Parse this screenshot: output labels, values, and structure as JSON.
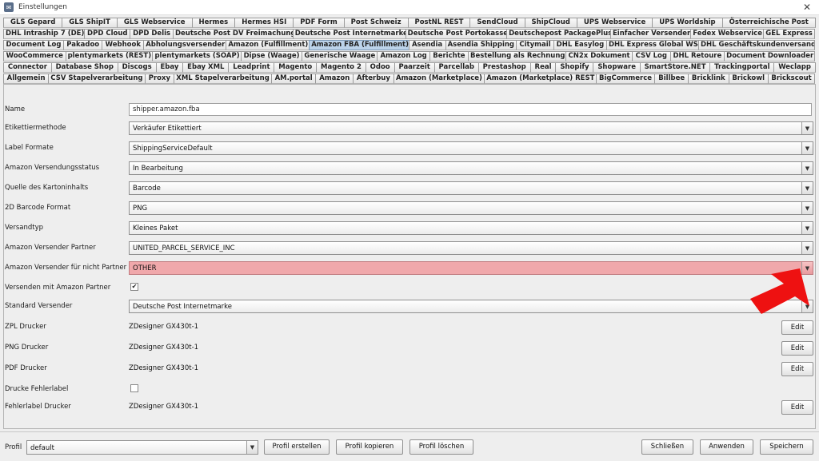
{
  "window": {
    "title": "Einstellungen",
    "close": "✕"
  },
  "tabs": {
    "row1": [
      "GLS Gepard",
      "GLS ShipIT",
      "GLS Webservice",
      "Hermes",
      "Hermes HSI",
      "PDF Form",
      "Post Schweiz",
      "PostNL REST",
      "SendCloud",
      "ShipCloud",
      "UPS Webservice",
      "UPS Worldship",
      "Österreichische Post"
    ],
    "row2": [
      "DHL Intraship 7 (DE)",
      "DPD Cloud",
      "DPD Delis",
      "Deutsche Post DV Freimachung",
      "Deutsche Post Internetmarke",
      "Deutsche Post Portokasse",
      "Deutschepost PackagePlus",
      "Einfacher Versender",
      "Fedex Webservice",
      "GEL Express"
    ],
    "row3": [
      "Document Log",
      "Pakadoo",
      "Webhook",
      "Abholungsversender",
      "Amazon (Fulfillment)",
      "Amazon FBA (Fulfillment)",
      "Asendia",
      "Asendia Shipping",
      "Citymail",
      "DHL Easylog",
      "DHL Express Global WS",
      "DHL Geschäftskundenversand"
    ],
    "row4": [
      "WooCommerce",
      "plentymarkets (REST)",
      "plentymarkets (SOAP)",
      "Dipse (Waage)",
      "Generische Waage",
      "Amazon Log",
      "Berichte",
      "Bestellung als Rechnung",
      "CN2x Dokument",
      "CSV Log",
      "DHL Retoure",
      "Document Downloader"
    ],
    "row5": [
      "Connector",
      "Database Shop",
      "Discogs",
      "Ebay",
      "Ebay XML",
      "Leadprint",
      "Magento",
      "Magento 2",
      "Odoo",
      "Paarzeit",
      "Parcellab",
      "Prestashop",
      "Real",
      "Shopify",
      "Shopware",
      "SmartStore.NET",
      "Trackingportal",
      "Weclapp"
    ],
    "row6": [
      "Allgemein",
      "CSV Stapelverarbeitung",
      "Proxy",
      "XML Stapelverarbeitung",
      "AM.portal",
      "Amazon",
      "Afterbuy",
      "Amazon (Marketplace)",
      "Amazon (Marketplace) REST",
      "BigCommerce",
      "Billbee",
      "Bricklink",
      "Brickowl",
      "Brickscout"
    ],
    "active": "Amazon FBA (Fulfillment)"
  },
  "form": {
    "name": {
      "label": "Name",
      "value": "shipper.amazon.fba"
    },
    "etikettiermethode": {
      "label": "Etikettiermethode",
      "value": "Verkäufer Etikettiert"
    },
    "label_formate": {
      "label": "Label Formate",
      "value": "ShippingServiceDefault"
    },
    "versendungsstatus": {
      "label": "Amazon Versendungsstatus",
      "value": "In Bearbeitung"
    },
    "kartoninhalt": {
      "label": "Quelle des Kartoninhalts",
      "value": "Barcode"
    },
    "barcode_format": {
      "label": "2D Barcode Format",
      "value": "PNG"
    },
    "versandtyp": {
      "label": "Versandtyp",
      "value": "Kleines Paket"
    },
    "versender_partner": {
      "label": "Amazon Versender Partner",
      "value": "UNITED_PARCEL_SERVICE_INC"
    },
    "versender_nicht_partner": {
      "label": "Amazon Versender für nicht Partner",
      "value": "OTHER"
    },
    "mit_partner": {
      "label": "Versenden mit Amazon Partner",
      "checked": "✔"
    },
    "standard_versender": {
      "label": "Standard Versender",
      "value": "Deutsche Post Internetmarke"
    },
    "zpl_drucker": {
      "label": "ZPL Drucker",
      "value": "ZDesigner GX430t-1"
    },
    "png_drucker": {
      "label": "PNG Drucker",
      "value": "ZDesigner GX430t-1"
    },
    "pdf_drucker": {
      "label": "PDF Drucker",
      "value": "ZDesigner GX430t-1"
    },
    "drucke_fehlerlabel": {
      "label": "Drucke Fehlerlabel",
      "checked": ""
    },
    "fehlerlabel_drucker": {
      "label": "Fehlerlabel Drucker",
      "value": "ZDesigner GX430t-1"
    },
    "edit_label": "Edit",
    "arrow_glyph": "▼"
  },
  "colors": {
    "alert_bg": "#f0a8ab",
    "active_tab": "#bcd3ea",
    "annotation_arrow": "#ee1111"
  },
  "footer": {
    "profil_label": "Profil",
    "profil_value": "default",
    "btn_create": "Profil erstellen",
    "btn_copy": "Profil kopieren",
    "btn_delete": "Profil löschen",
    "btn_close": "Schließen",
    "btn_apply": "Anwenden",
    "btn_save": "Speichern"
  }
}
